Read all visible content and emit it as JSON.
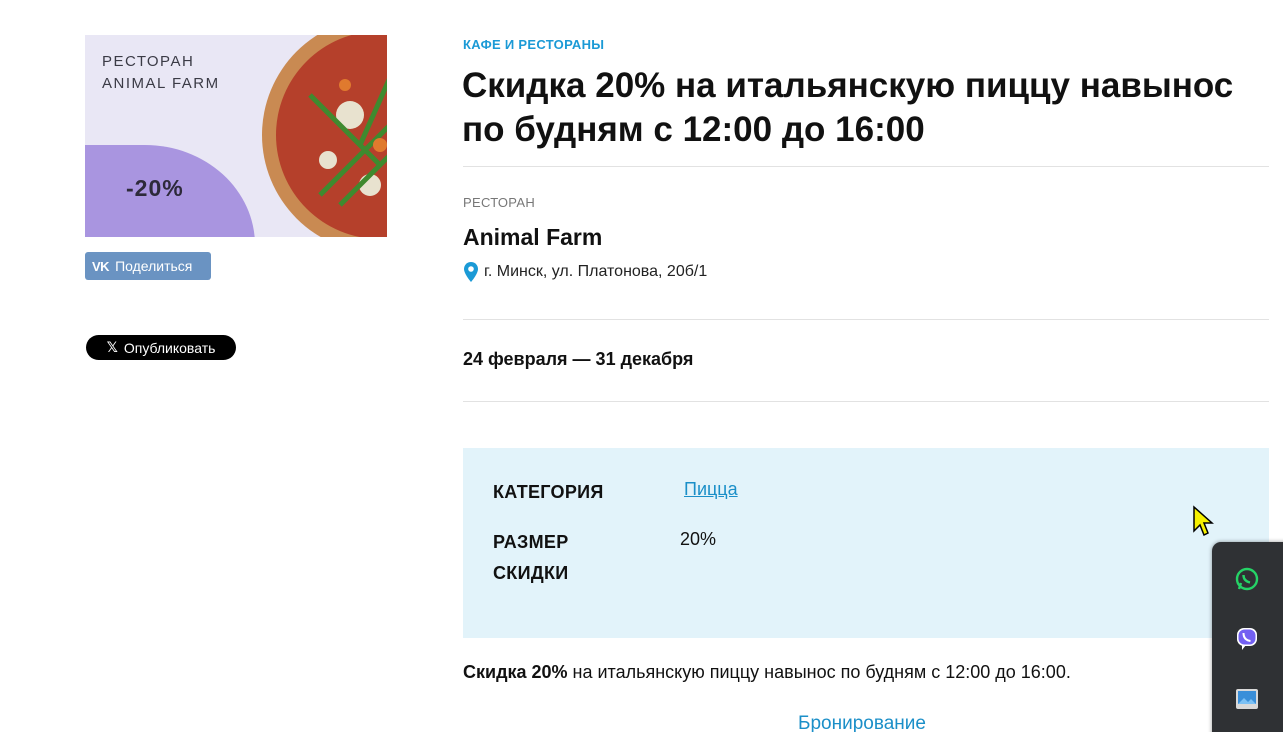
{
  "promo": {
    "restaurant_line1": "РЕСТОРАН",
    "restaurant_line2": "ANIMAL FARM",
    "discount": "-20%"
  },
  "share": {
    "vk_icon": "VK",
    "vk_label": "Поделиться",
    "x_icon": "𝕏",
    "x_label": "Опубликовать"
  },
  "header": {
    "category_kicker": "КАФЕ И РЕСТОРАНЫ",
    "title": "Скидка 20% на итальянскую пиццу навынос по будням с 12:00 до 16:00"
  },
  "place": {
    "kicker": "РЕСТОРАН",
    "name": "Animal Farm",
    "address": "г. Минск, ул. Платонова, 20б/1"
  },
  "dates": "24 февраля — 31 декабря",
  "info": {
    "category_label": "КАТЕГОРИЯ",
    "category_value": "Пицца",
    "size_label_line1": "РАЗМЕР",
    "size_label_line2": "СКИДКИ",
    "size_value": "20%"
  },
  "description": {
    "bold": "Скидка 20%",
    "rest": " на итальянскую пиццу навынос по будням с 12:00 до 16:00."
  },
  "booking_link": "Бронирование",
  "messenger": [
    "whatsapp-icon",
    "viber-icon",
    "image-icon"
  ],
  "colors": {
    "accent": "#1b9ad6",
    "info_bg": "#e2f3fa",
    "promo_purple": "#a995e0",
    "vk_blue": "#5181b8"
  }
}
